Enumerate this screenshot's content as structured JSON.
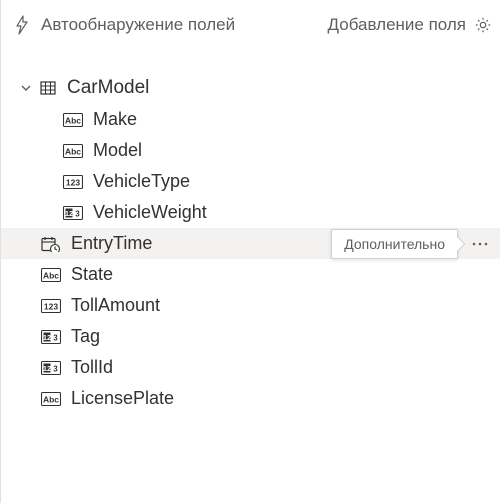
{
  "header": {
    "autodetect_label": "Автообнаружение полей",
    "addfield_label": "Добавление поля"
  },
  "group": {
    "name": "CarModel"
  },
  "fields": {
    "nested": [
      {
        "label": "Make",
        "type": "abc"
      },
      {
        "label": "Model",
        "type": "abc"
      },
      {
        "label": "VehicleType",
        "type": "num"
      },
      {
        "label": "VehicleWeight",
        "type": "numkey"
      }
    ],
    "level1": [
      {
        "label": "EntryTime",
        "type": "datetime",
        "hovered": true,
        "tooltip": "Дополнительно"
      },
      {
        "label": "State",
        "type": "abc"
      },
      {
        "label": "TollAmount",
        "type": "num"
      },
      {
        "label": "Tag",
        "type": "numkey"
      },
      {
        "label": "TollId",
        "type": "numkey"
      },
      {
        "label": "LicensePlate",
        "type": "abc"
      }
    ]
  }
}
